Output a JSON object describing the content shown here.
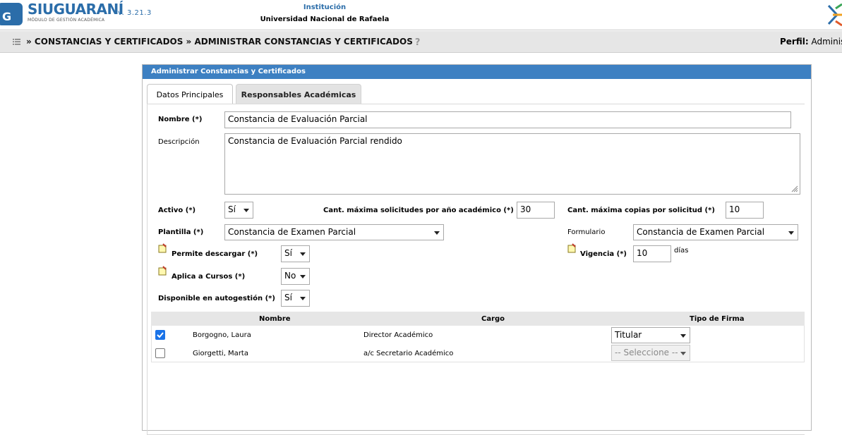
{
  "header": {
    "logo_siu": "SIU",
    "logo_guarani": "GUARANÍ",
    "logo_subtitle": "MÓDULO DE GESTIÓN ACADÉMICA",
    "logo_badge": "G",
    "version": "v. 3.21.3",
    "institution_label": "Institución",
    "institution_name": "Universidad Nacional de Rafaela"
  },
  "breadcrumb": {
    "text": "» CONSTANCIAS Y CERTIFICADOS » ADMINISTRAR CONSTANCIAS Y CERTIFICADOS",
    "help": "?",
    "perfil_label": "Perfil:",
    "perfil_value": "Adminis"
  },
  "panel": {
    "title": "Administrar Constancias y Certificados",
    "tabs": [
      {
        "label": "Datos Principales"
      },
      {
        "label": "Responsables Académicas"
      }
    ]
  },
  "form": {
    "nombre_label": "Nombre (*)",
    "nombre_value": "Constancia de Evaluación Parcial",
    "descripcion_label": "Descripción",
    "descripcion_value": "Constancia de Evaluación Parcial rendido",
    "activo_label": "Activo (*)",
    "activo_value": "Sí",
    "cant_solicitudes_label": "Cant. máxima solicitudes por año académico (*)",
    "cant_solicitudes_value": "30",
    "cant_copias_label": "Cant. máxima copias por solicitud (*)",
    "cant_copias_value": "10",
    "plantilla_label": "Plantilla (*)",
    "plantilla_value": "Constancia de Examen Parcial",
    "formulario_label": "Formulario",
    "formulario_value": "Constancia de Examen Parcial",
    "permite_descargar_label": "Permite descargar (*)",
    "permite_descargar_value": "Sí",
    "vigencia_label": "Vigencia (*)",
    "vigencia_value": "10",
    "vigencia_unit": "días",
    "aplica_cursos_label": "Aplica a Cursos (*)",
    "aplica_cursos_value": "No",
    "disponible_label": "Disponible en autogestión (*)",
    "disponible_value": "Sí"
  },
  "table": {
    "columns": [
      "Nombre",
      "Cargo",
      "Tipo de Firma"
    ],
    "rows": [
      {
        "checked": true,
        "nombre": "Borgogno, Laura",
        "cargo": "Director Académico",
        "firma": "Titular"
      },
      {
        "checked": false,
        "nombre": "Giorgetti, Marta",
        "cargo": "a/c Secretario Académico",
        "firma": "-- Seleccione --"
      }
    ]
  },
  "colors": {
    "brand_blue": "#2b6da9",
    "panel_title_bg": "#3d80c2",
    "checkbox_on": "#1a73e8"
  }
}
